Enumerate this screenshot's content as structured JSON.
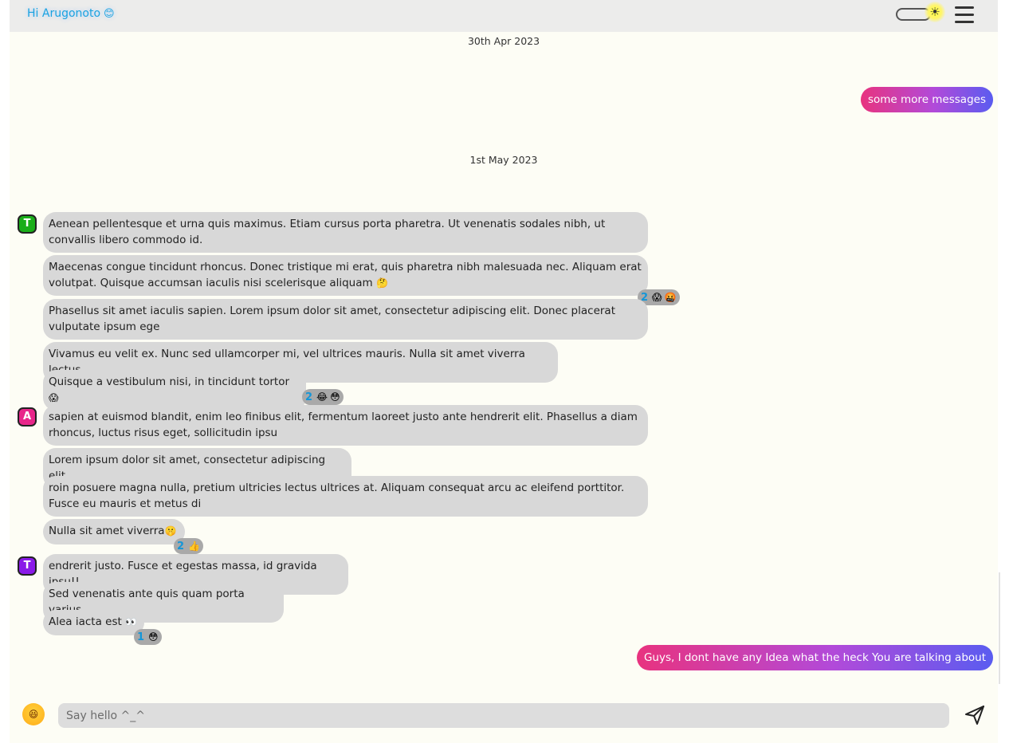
{
  "header": {
    "greeting": "Hi Arugonoto",
    "greeting_emoji": "😊",
    "sun_icon": "☀"
  },
  "dates": [
    "30th Apr 2023",
    "1st May 2023"
  ],
  "outgoing": [
    "some more messages",
    "Guys, I dont have any Idea what the heck You are talking about"
  ],
  "groups": [
    {
      "avatar": {
        "letter": "T",
        "color": "#1aae1a"
      },
      "messages": [
        {
          "text": "Aenean pellentesque et urna quis maximus. Etiam cursus porta pharetra. Ut venenatis sodales nibh, ut convallis libero commodo id."
        },
        {
          "text": "Maecenas congue tincidunt rhoncus. Donec tristique mi erat, quis pharetra nibh malesuada nec. Aliquam erat volutpat. Quisque accumsan iaculis nisi scelerisque aliquam",
          "emoji": "🤔"
        },
        {
          "text": "Phasellus sit amet iaculis sapien. Lorem ipsum dolor sit amet, consectetur adipiscing elit. Donec placerat vulputate ipsum ege"
        },
        {
          "text": "Vivamus eu velit ex. Nunc sed ullamcorper mi, vel ultrices mauris. Nulla sit amet viverra lectus,"
        },
        {
          "text": "Quisque a vestibulum nisi, in tincidunt tortor",
          "emoji": "😱"
        }
      ]
    },
    {
      "avatar": {
        "letter": "A",
        "color": "#e8268a"
      },
      "messages": [
        {
          "text": "sapien at euismod blandit, enim leo finibus elit, fermentum laoreet justo ante hendrerit elit. Phasellus a diam rhoncus, luctus risus eget, sollicitudin ipsu"
        },
        {
          "text": "Lorem ipsum dolor sit amet, consectetur adipiscing elit."
        },
        {
          "text": "roin posuere magna nulla, pretium ultricies lectus ultrices at. Aliquam consequat arcu ac eleifend porttitor. Fusce eu mauris et metus di"
        },
        {
          "text": "Nulla sit amet viverra",
          "emoji": "🤫"
        }
      ]
    },
    {
      "avatar": {
        "letter": "T",
        "color": "#8a1ae8"
      },
      "messages": [
        {
          "text": "endrerit justo. Fusce et egestas massa, id gravida ipsu!!"
        },
        {
          "text": "Sed venenatis ante quis quam porta varius"
        },
        {
          "text": "Alea iacta est",
          "emoji": "👀"
        }
      ]
    }
  ],
  "reactions": [
    {
      "count": "2",
      "emojis": [
        "😱",
        "🤬"
      ]
    },
    {
      "count": "2",
      "emojis": [
        "😂",
        "😳"
      ]
    },
    {
      "count": "2",
      "emojis": [
        "👍"
      ]
    },
    {
      "count": "1",
      "emojis": [
        "😳"
      ]
    }
  ],
  "footer": {
    "emoji_button": "😆",
    "input_placeholder": "Say hello ^_^",
    "input_value": ""
  }
}
